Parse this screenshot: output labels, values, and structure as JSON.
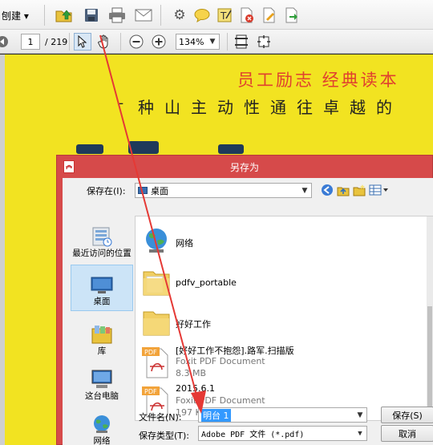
{
  "toolbar": {
    "create_label": "刨建 ▾",
    "page_current": "1",
    "page_total": "/ 219",
    "zoom_value": "134%"
  },
  "document": {
    "headline": "员工励志   经典读本",
    "subline": "种山主动性通往卓越的"
  },
  "dialog": {
    "title": "另存为",
    "save_in_label": "保存在(I):",
    "save_in_value": "桌面",
    "places": [
      {
        "label": "最近访问的位置"
      },
      {
        "label": "桌面"
      },
      {
        "label": "库"
      },
      {
        "label": "这台电脑"
      },
      {
        "label": "网络"
      }
    ],
    "files": [
      {
        "name": "网络",
        "type": "",
        "size": ""
      },
      {
        "name": "pdfv_portable",
        "type": "",
        "size": ""
      },
      {
        "name": "好好工作",
        "type": "",
        "size": ""
      },
      {
        "name": "[好好工作不抱怨].路军.扫描版",
        "type": "Foxit PDF Document",
        "size": "8.3 MB"
      },
      {
        "name": "2015.6.1",
        "type": "Foxit PDF Document",
        "size": "197 KB"
      }
    ],
    "pdf_badge": "PDF",
    "filename_label": "文件名(N):",
    "filename_value": "明台 1",
    "filetype_label": "保存类型(T):",
    "filetype_value": "Adobe PDF 文件 (*.pdf)",
    "save_button": "保存(S)",
    "cancel_button": "取消"
  },
  "colors": {
    "accent_red": "#e53935",
    "dialog_frame": "#d64a4a",
    "document_bg": "#f2e321"
  }
}
